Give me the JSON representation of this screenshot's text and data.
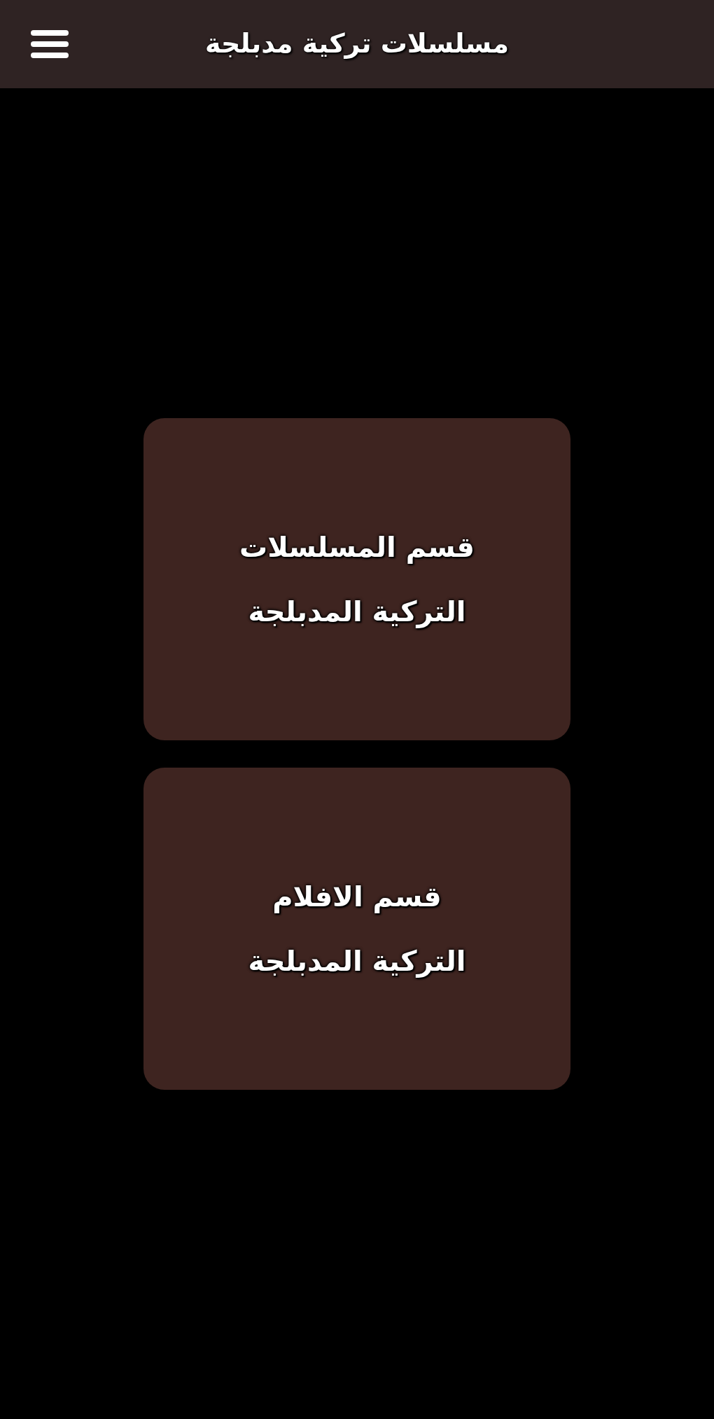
{
  "app_bar": {
    "title": "مسلسلات تركية مدبلجة"
  },
  "sections": [
    {
      "label_lines": [
        "قسم المسلسلات",
        "التركية المدبلجة"
      ]
    },
    {
      "label_lines": [
        "قسم الافلام",
        "التركية المدبلجة"
      ]
    }
  ]
}
